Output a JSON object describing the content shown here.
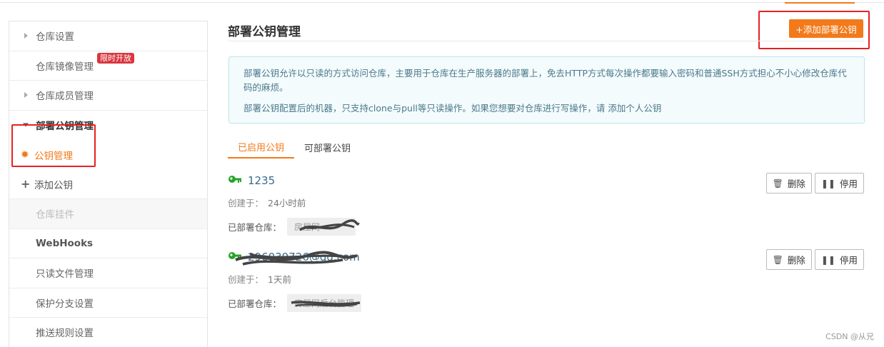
{
  "sidebar": {
    "items": [
      {
        "label": "仓库设置"
      },
      {
        "label": "仓库镜像管理",
        "badge": "限时开放"
      },
      {
        "label": "仓库成员管理"
      },
      {
        "label": "部署公钥管理"
      },
      {
        "label": "公钥管理"
      },
      {
        "label": "添加公钥"
      },
      {
        "label": "仓库挂件"
      },
      {
        "label": "WebHooks"
      },
      {
        "label": "只读文件管理"
      },
      {
        "label": "保护分支设置"
      },
      {
        "label": "推送规则设置"
      }
    ]
  },
  "main": {
    "title": "部署公钥管理",
    "add_button": "+添加部署公钥",
    "info": {
      "line1": "部署公钥允许以只读的方式访问仓库，主要用于仓库在生产服务器的部署上，免去HTTP方式每次操作都要输入密码和普通SSH方式担心不小心修改仓库代码的麻烦。",
      "line2": "部署公钥配置后的机器，只支持clone与pull等只读操作。如果您想要对仓库进行写操作，请 添加个人公钥"
    },
    "tabs": [
      {
        "label": "已启用公钥",
        "active": true
      },
      {
        "label": "可部署公钥",
        "active": false
      }
    ],
    "keys": [
      {
        "name": "1235",
        "created_label": "创建于：",
        "created": "24小时前",
        "repo_label": "已部署仓库：",
        "repo": "房屋网"
      },
      {
        "name": "296039726@qq.com",
        "created_label": "创建于：",
        "created": "1天前",
        "repo_label": "已部署仓库：",
        "repo": "房屋网后台管理"
      }
    ],
    "delete_label": "删除",
    "disable_label": "停用"
  },
  "watermark": "CSDN @从兄",
  "colors": {
    "accent": "#f27a1a",
    "badge": "#d9363e",
    "annotation": "#e52222",
    "key": "#26a526"
  }
}
